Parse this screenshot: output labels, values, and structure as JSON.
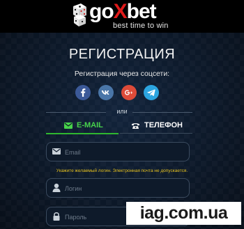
{
  "brand": {
    "name_prefix": "go",
    "name_x": "X",
    "name_suffix": "bet",
    "tagline": "best time to win"
  },
  "registration": {
    "title": "РЕГИСТРАЦИЯ",
    "social_label": "Регистрация через соцсети:",
    "social": [
      {
        "name": "facebook",
        "color": "#3b5998",
        "glyph": "f"
      },
      {
        "name": "vk",
        "color": "#4a76a8",
        "glyph": "vk"
      },
      {
        "name": "google-plus",
        "color": "#dd4b39",
        "glyph": "g+"
      },
      {
        "name": "telegram",
        "color": "#2ca5e0",
        "glyph": "telegram"
      }
    ],
    "or_text": "или",
    "tabs": [
      {
        "label": "E-MAIL",
        "icon": "envelope-icon",
        "active": true
      },
      {
        "label": "ТЕЛЕФОН",
        "icon": "phone-icon",
        "active": false
      }
    ],
    "fields": {
      "email_placeholder": "Email",
      "login_placeholder": "Логин",
      "password_placeholder": "Пароль"
    },
    "login_hint": "Укажите желаемый логин. Электронная почта не допускается.",
    "accent_color": "#2fb82f"
  },
  "watermark": "iag.com.ua"
}
